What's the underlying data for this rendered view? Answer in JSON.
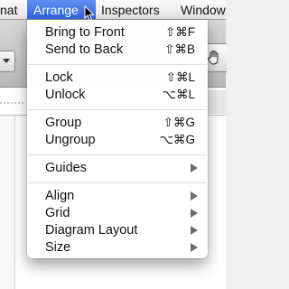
{
  "menubar": {
    "items": [
      {
        "label": "nat",
        "active": false
      },
      {
        "label": "Arrange",
        "active": true
      },
      {
        "label": "Inspectors",
        "active": false
      },
      {
        "label": "Window",
        "active": false
      }
    ]
  },
  "arrange_menu": {
    "groups": [
      [
        {
          "label": "Bring to Front",
          "shortcut": "⇧⌘F"
        },
        {
          "label": "Send to Back",
          "shortcut": "⇧⌘B"
        }
      ],
      [
        {
          "label": "Lock",
          "shortcut": "⇧⌘L"
        },
        {
          "label": "Unlock",
          "shortcut": "⌥⌘L"
        }
      ],
      [
        {
          "label": "Group",
          "shortcut": "⇧⌘G"
        },
        {
          "label": "Ungroup",
          "shortcut": "⌥⌘G"
        }
      ],
      [
        {
          "label": "Guides",
          "submenu": true
        }
      ],
      [
        {
          "label": "Align",
          "submenu": true
        },
        {
          "label": "Grid",
          "submenu": true
        },
        {
          "label": "Diagram Layout",
          "submenu": true
        },
        {
          "label": "Size",
          "submenu": true
        }
      ]
    ]
  },
  "colors": {
    "menu_highlight": "#3a6ee8",
    "menu_text": "#111111",
    "submenu_arrow": "#6b6b6b"
  },
  "icons": {
    "toolbar_right": "hand-icon",
    "toolbar_left": "chevron-down-icon",
    "pointer": "arrow-cursor-icon"
  }
}
